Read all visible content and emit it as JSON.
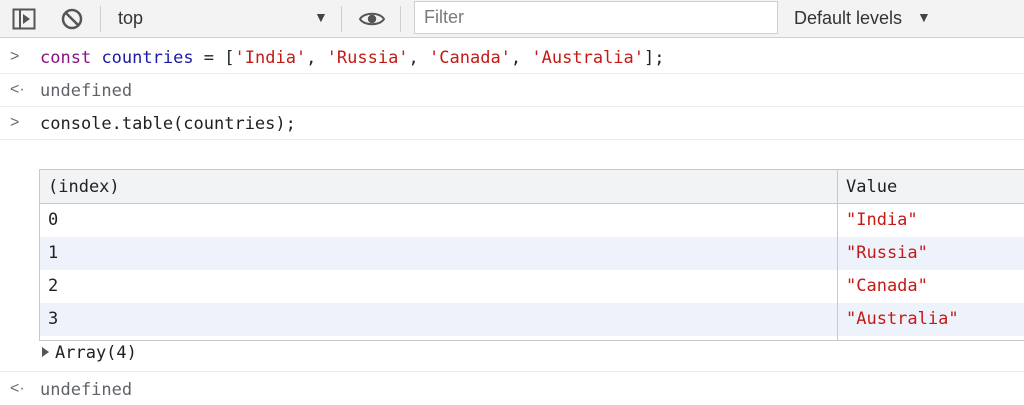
{
  "toolbar": {
    "context": "top",
    "filter_placeholder": "Filter",
    "levels_label": "Default levels"
  },
  "console": {
    "input1": {
      "keyword": "const",
      "variable": "countries",
      "equals": " = [",
      "items": [
        "'India'",
        "'Russia'",
        "'Canada'",
        "'Australia'"
      ],
      "sep": ", ",
      "close": "];"
    },
    "output1": "undefined",
    "input2": "console.table(countries);",
    "table": {
      "headers": [
        "(index)",
        "Value"
      ],
      "rows": [
        {
          "index": "0",
          "value": "\"India\""
        },
        {
          "index": "1",
          "value": "\"Russia\""
        },
        {
          "index": "2",
          "value": "\"Canada\""
        },
        {
          "index": "3",
          "value": "\"Australia\""
        }
      ]
    },
    "array_label": "Array(4)",
    "output2": "undefined"
  },
  "colors": {
    "keyword": "#881280",
    "variable": "#1a1aa6",
    "string": "#c41a16",
    "row_alt": "#eef3fb"
  }
}
